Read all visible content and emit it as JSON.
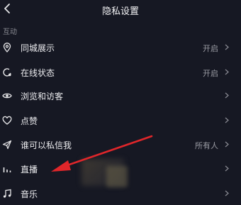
{
  "header": {
    "title": "隐私设置"
  },
  "section": {
    "title": "互动"
  },
  "rows": [
    {
      "label": "同城展示",
      "value": "开启",
      "icon": "location-pin-icon"
    },
    {
      "label": "在线状态",
      "value": "开启",
      "icon": "online-status-icon"
    },
    {
      "label": "浏览和访客",
      "value": "",
      "icon": "eye-icon"
    },
    {
      "label": "点赞",
      "value": "",
      "icon": "heart-icon"
    },
    {
      "label": "谁可以私信我",
      "value": "所有人",
      "icon": "send-icon"
    },
    {
      "label": "直播",
      "value": "",
      "icon": "live-bars-icon"
    },
    {
      "label": "音乐",
      "value": "",
      "icon": "music-icon"
    }
  ],
  "colors": {
    "background": "#161823",
    "arrow": "#e0262a"
  }
}
